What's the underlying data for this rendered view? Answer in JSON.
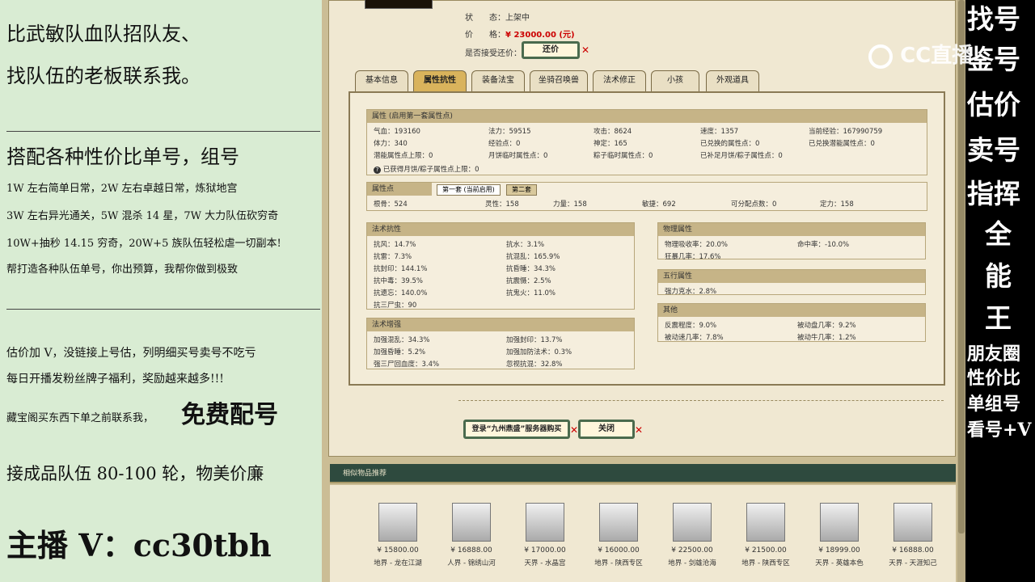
{
  "left": {
    "l1": "比武敏队血队招队友、",
    "l2": "找队伍的老板联系我。",
    "l3": "搭配各种性价比单号，组号",
    "l4": "1W 左右简单日常，2W 左右卓越日常，炼狱地宫",
    "l5": "3W 左右异光通关，5W 混杀 14 星，7W 大力队伍砍穷奇",
    "l6": "10W+抽秒 14.15 穷奇，20W+5 族队伍轻松虐一切副本!",
    "l7": "帮打造各种队伍单号，你出预算，我帮你做到极致",
    "l8": "估价加 V，没链接上号估，列明细买号卖号不吃亏",
    "l9": "每日开播发粉丝牌子福利，奖励越来越多!!!",
    "l10a": "藏宝阁买东西下单之前联系我，",
    "l10b": "免费配号",
    "l11": "接成品队伍 80-100 轮，物美价廉",
    "l12": "主播 V：cc30tbh"
  },
  "right": {
    "c1": [
      "找",
      "号"
    ],
    "c2": [
      "鉴",
      "号"
    ],
    "c3": [
      "估",
      "价"
    ],
    "c4": [
      "卖",
      "号"
    ],
    "c5": [
      "指",
      "挥"
    ],
    "c6": "全",
    "c7": "能",
    "c8": "王",
    "s1": "朋友圈",
    "s2": "性价比",
    "s3": "单组号",
    "s4": "看号+V",
    "logo": "CC直播"
  },
  "game": {
    "status_label": "状　　态：",
    "status": "上架中",
    "price_label": "价　　格：",
    "price": "¥ 23000.00 (元)",
    "bargain_label": "是否接受还价：",
    "bargain_btn": "还价",
    "tabs": [
      "基本信息",
      "属性抗性",
      "装备法宝",
      "坐骑召唤兽",
      "法术修正",
      "小孩",
      "外观道具"
    ],
    "attr_title": "属性 (启用第一套属性点)",
    "attr": [
      [
        "气血：193160",
        "法力：59515",
        "攻击：8624",
        "速度：1357",
        "当前经验：167990759"
      ],
      [
        "体力：340",
        "经验点：0",
        "神定：165",
        "已兑换的属性点：0",
        "已兑换潜能属性点：0"
      ],
      [
        "潜能属性点上限：0",
        "月饼临时属性点：0",
        "粽子临时属性点：0",
        "已补足月饼/粽子属性点：0",
        ""
      ]
    ],
    "attr_note": "已获得月饼/粽子属性点上限：0",
    "pts_title": "属性点",
    "pts_tab1": "第一套 (当前启用)",
    "pts_tab2": "第二套",
    "pts": [
      "根骨：524",
      "灵性：158",
      "力量：158",
      "敏捷：692",
      "可分配点数：0",
      "定力：158"
    ],
    "res_title": "法术抗性",
    "res": [
      [
        "抗风：14.7%",
        "抗水：3.1%"
      ],
      [
        "抗雷：7.3%",
        "抗混乱：165.9%"
      ],
      [
        "抗封印：144.1%",
        "抗昏睡：34.3%"
      ],
      [
        "抗中毒：39.5%",
        "抗震慑：2.5%"
      ],
      [
        "抗遗忘：140.0%",
        "抗鬼火：11.0%"
      ],
      [
        "抗三尸虫：90",
        ""
      ]
    ],
    "enh_title": "法术增强",
    "enh": [
      [
        "加强混乱：34.3%",
        "加强封印：13.7%"
      ],
      [
        "加强昏睡：5.2%",
        "加强加防法术：0.3%"
      ],
      [
        "强三尸回血度：3.4%",
        "忽视抗混：32.8%"
      ]
    ],
    "phys_title": "物理属性",
    "phys": [
      [
        "物理吸收率：20.0%",
        "命中率：-10.0%"
      ],
      [
        "狂暴几率：17.6%",
        ""
      ]
    ],
    "five_title": "五行属性",
    "five": "强力克水：2.8%",
    "other_title": "其他",
    "other": [
      [
        "反震程度：9.0%",
        "被动盘几率：9.2%"
      ],
      [
        "被动速几率：7.8%",
        "被动牛几率：1.2%"
      ]
    ],
    "buy_btn": "登录“九州鼎盛”服务器购买",
    "close_btn": "关闭",
    "similar_title": "相似物品推荐",
    "items": [
      {
        "price": "¥ 15800.00",
        "server": "地界 - 龙在江湖"
      },
      {
        "price": "¥ 16888.00",
        "server": "人界 - 锦绣山河"
      },
      {
        "price": "¥ 17000.00",
        "server": "天界 - 水晶宫"
      },
      {
        "price": "¥ 16000.00",
        "server": "地界 - 陕西专区"
      },
      {
        "price": "¥ 22500.00",
        "server": "地界 - 剑雄沧海"
      },
      {
        "price": "¥ 21500.00",
        "server": "地界 - 陕西专区"
      },
      {
        "price": "¥ 18999.00",
        "server": "天界 - 英雄本色"
      },
      {
        "price": "¥ 16888.00",
        "server": "天界 - 天涯知己"
      }
    ]
  }
}
